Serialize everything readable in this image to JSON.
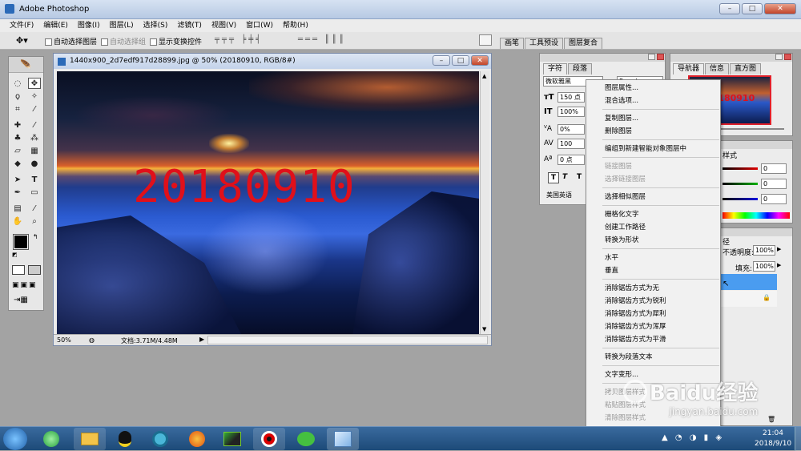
{
  "app": {
    "title": "Adobe Photoshop"
  },
  "menubar": [
    "文件(F)",
    "编辑(E)",
    "图像(I)",
    "图层(L)",
    "选择(S)",
    "滤镜(T)",
    "视图(V)",
    "窗口(W)",
    "帮助(H)"
  ],
  "options": {
    "auto_select": "自动选择图层",
    "auto_group": "自动选择组",
    "show_transform": "显示变换控件",
    "dock_tabs": [
      "画笔",
      "工具预设",
      "图层复合"
    ]
  },
  "document": {
    "title": "1440x900_2d7edf917d28899.jpg @ 50% (20180910, RGB/8#)",
    "overlay_text": "20180910",
    "zoom": "50%",
    "doc_info": "文档:3.71M/4.48M"
  },
  "char_panel": {
    "tabs": [
      "字符",
      "段落"
    ],
    "font": "微软雅黑",
    "style": "Regular",
    "size": "150 点",
    "vscale": "100%",
    "tracking": "0%",
    "kerning": "100",
    "baseline": "0 点",
    "lang": "美国英语",
    "style_btns": [
      "T",
      "T",
      "T"
    ]
  },
  "nav_panel": {
    "tabs": [
      "导航器",
      "信息",
      "直方图"
    ],
    "thumb_text": "20180910"
  },
  "color_panel": {
    "tab": "样式",
    "rgb": [
      "0",
      "0",
      "0"
    ]
  },
  "layers_panel": {
    "tab": "径",
    "opacity_label": "不透明度:",
    "opacity": "100%",
    "fill_label": "填充:",
    "fill": "100%"
  },
  "context_menu": {
    "items": [
      {
        "label": "图层属性...",
        "enabled": true
      },
      {
        "label": "混合选项...",
        "enabled": true
      },
      {
        "label": "复制图层...",
        "enabled": true
      },
      {
        "label": "删除图层",
        "enabled": true
      },
      {
        "label": "编组到新建智能对象图层中",
        "enabled": true
      },
      {
        "label": "链接图层",
        "enabled": false
      },
      {
        "label": "选择链接图层",
        "enabled": false
      },
      {
        "label": "选择相似图层",
        "enabled": true
      },
      {
        "label": "栅格化文字",
        "enabled": true
      },
      {
        "label": "创建工作路径",
        "enabled": true
      },
      {
        "label": "转换为形状",
        "enabled": true
      },
      {
        "label": "水平",
        "enabled": true
      },
      {
        "label": "垂直",
        "enabled": true
      },
      {
        "label": "消除锯齿方式为无",
        "enabled": true
      },
      {
        "label": "消除锯齿方式为锐利",
        "enabled": true
      },
      {
        "label": "消除锯齿方式为犀利",
        "enabled": true
      },
      {
        "label": "消除锯齿方式为浑厚",
        "enabled": true
      },
      {
        "label": "消除锯齿方式为平滑",
        "enabled": true
      },
      {
        "label": "转换为段落文本",
        "enabled": true
      },
      {
        "label": "文字变形...",
        "enabled": true
      },
      {
        "label": "拷贝图层样式",
        "enabled": false
      },
      {
        "label": "粘贴图层样式",
        "enabled": false
      },
      {
        "label": "清除图层样式",
        "enabled": false
      }
    ]
  },
  "watermark": {
    "text": "Baidu经验",
    "sub": "jingyan.baidu.com"
  },
  "taskbar": {
    "time": "21:04",
    "date": "2018/9/10",
    "apps": [
      "ie-icon",
      "explorer-icon",
      "qq-icon",
      "media-icon",
      "firefox-icon",
      "video-icon",
      "recorder-icon",
      "wechat-icon",
      "photoshop-icon"
    ]
  },
  "colors": {
    "overlay_text": "#e0101a",
    "title_bar": "#c3d3ea",
    "selected_layer": "#4a9cf0",
    "taskbar": "#1d4a78"
  }
}
